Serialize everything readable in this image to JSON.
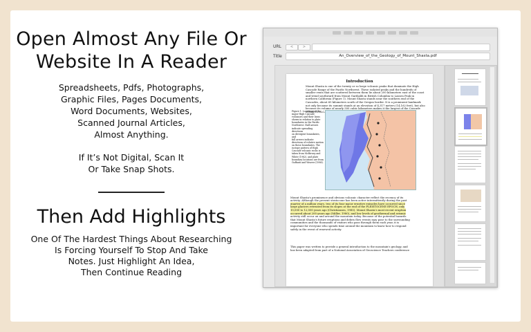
{
  "left": {
    "headline1": "Open Almost Any File Or\nWebsite In A Reader",
    "filetypes": "Spreadsheets, Pdfs, Photographs,\nGraphic Files, Pages Documents,\nWord Documents, Websites,\nScanned  Journal  Articles,\nAlmost Anything.",
    "scan_note": "If It’s Not Digital, Scan It\nOr Take Snap Shots.",
    "headline2": "Then Add Highlights",
    "highlight_note": "One Of The Hardest Things About Researching\nIs Forcing Yourself To Stop And Take\nNotes.  Just Highlight An Idea,\nThen Continue Reading"
  },
  "window": {
    "url_label": "URL",
    "title_label": "Title",
    "back_label": "<",
    "forward_label": ">",
    "url_value": "",
    "title_value": "An_Overview_of_the_Geology_of_Mount_Shasta.pdf"
  },
  "document": {
    "heading": "Introduction",
    "para1": "Mount Shasta is one of the twenty or so large volcanic peaks that dominate the High\nCascade Range of the Pacific Northwest.  These isolated peaks and the hundreds of\nsmaller vents that are scattered between them lie about 200 kilometers east of the coast\nand trend southward from Mount Garibaldi in British Columbia to Lassen Peak in\nnorthern California (Figure 1).  Mount Shasta stands near the southern end of the\nCascades, about 65 kilometers south of the Oregon border.  It is a prominent landmark\nnot only because its summit stands at an elevation of 4,317 meters (14,162 feet), but also\nbecause its volume of nearly 500 cubic kilometers makes it the largest of the Cascade\nSTRATOVOLCANOES (Christiansen and Miller, 1989).",
    "figure_caption": "Figure 1. Locations of the\nmajor High Cascade\nvolcanoes and their lavas\nshown in relation to plate\nboundaries in the Pacific\nNorthwest.  Half arrows\nindicate spreading directions\non divergent boundaries, and\nfull arrows indicate\ndirections of relative motion\non these boundaries.  The\nisotope pattern of High\nCascade volcanic rocks is\ntaken from McBirney and\nWhite (1982), and plate\nboundary locations are from\nGuffanti and Weaver (1988).",
    "para2_a": "Mount Shasta's prominence and obvious volcanic character reflect the recency of its\nactivity.  Although the present stratocone has been active intermittently during the past",
    "para2_hl": "quarter of a million years, two of its four major eruptive episodes have occurred since\nlarge glaciers retreated from its slopes at the end of the PLEISTOCENE EPOCH, only\n10,000 to 12,000 years ago (Christiansen, 1985).  Mount Shasta's most recent eruption\noccurred about 200 years ago (Miller, 1980), and low levels of geothermal and seismic",
    "para2_b": "activity still occur on and around the mountain today.  Because of the potential hazards\nthat Mount Shasta's future eruptions and debris flow events may pose to the surrounding\ncommunities and the thousands of visitors who pass through them each year, it is\nimportant for everyone who spends time around the mountain to know how to respond\nsafely in the event of renewed activity.",
    "para3": "This paper was written to provide a general introduction to the mountain's geology, and\nhas been adapted from part of a National Association of Geoscience Teachers conference"
  },
  "colors": {
    "background": "#f1e3cf",
    "highlight": "#f6f3a6"
  }
}
